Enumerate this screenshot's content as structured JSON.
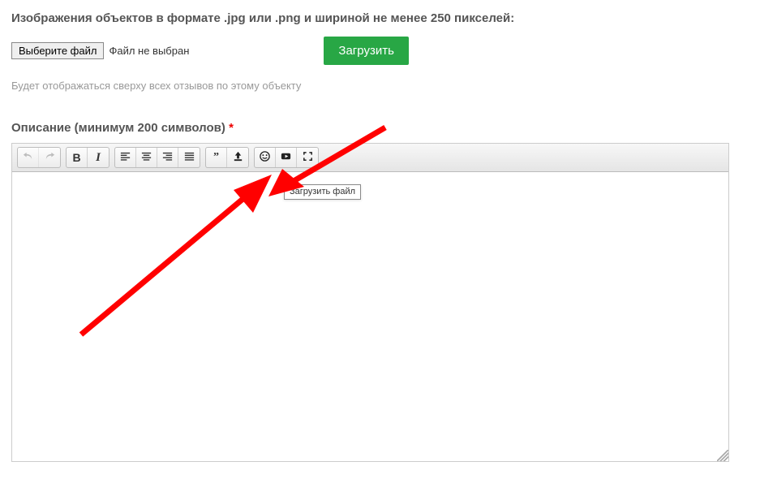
{
  "heading": "Изображения объектов в формате .jpg или .png и шириной не менее 250 пикселей:",
  "file_button": "Выберите файл",
  "file_status": "Файл не выбран",
  "upload_button": "Загрузить",
  "hint": "Будет отображаться сверху всех отзывов по этому объекту",
  "desc_label": "Описание (минимум 200 символов)",
  "required_mark": "*",
  "toolbar": {
    "undo": "undo",
    "redo": "redo",
    "bold": "B",
    "italic": "I",
    "align_left": "align-left",
    "align_center": "align-center",
    "align_right": "align-right",
    "align_justify": "align-justify",
    "quote": "„",
    "upload": "upload",
    "emoji": "emoji",
    "video": "video",
    "fullscreen": "fullscreen"
  },
  "tooltip": "Загрузить файл",
  "colors": {
    "green": "#28a745",
    "arrow": "#ff0000"
  }
}
